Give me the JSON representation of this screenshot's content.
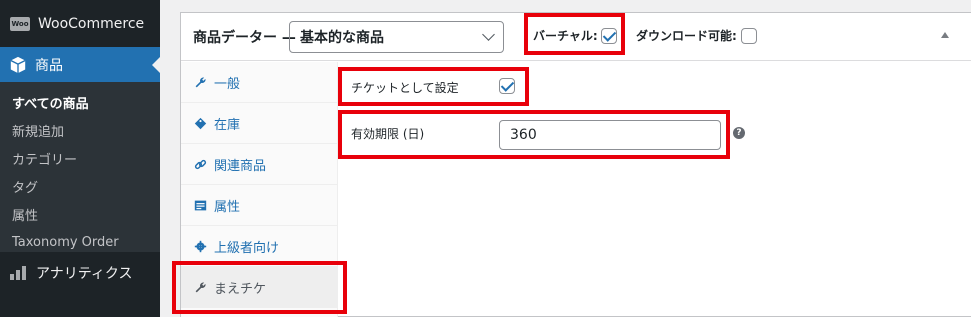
{
  "sidebar": {
    "brand": "WooCommerce",
    "brand_logo_text": "Woo",
    "active": "商品",
    "items": [
      {
        "label": "すべての商品"
      },
      {
        "label": "新規追加"
      },
      {
        "label": "カテゴリー"
      },
      {
        "label": "タグ"
      },
      {
        "label": "属性"
      },
      {
        "label": "Taxonomy Order"
      }
    ],
    "analytics": "アナリティクス"
  },
  "panel": {
    "title": "商品データー —",
    "product_type": "基本的な商品",
    "virtual_label": "バーチャル:",
    "virtual_checked": true,
    "download_label": "ダウンロード可能:",
    "download_checked": false
  },
  "tabs": [
    {
      "label": "一般",
      "icon": "wrench-icon"
    },
    {
      "label": "在庫",
      "icon": "tag-icon"
    },
    {
      "label": "関連商品",
      "icon": "link-icon"
    },
    {
      "label": "属性",
      "icon": "table-icon"
    },
    {
      "label": "上級者向け",
      "icon": "gear-icon"
    },
    {
      "label": "まえチケ",
      "icon": "wrench-icon",
      "active": true
    }
  ],
  "fields": {
    "ticket_label": "チケットとして設定",
    "ticket_checked": true,
    "days_label": "有効期限 (日)",
    "days_value": "360",
    "help": "?"
  },
  "colors": {
    "accent": "#2271b1",
    "highlight": "#e8000a",
    "sidebar_bg": "#1d2327"
  }
}
